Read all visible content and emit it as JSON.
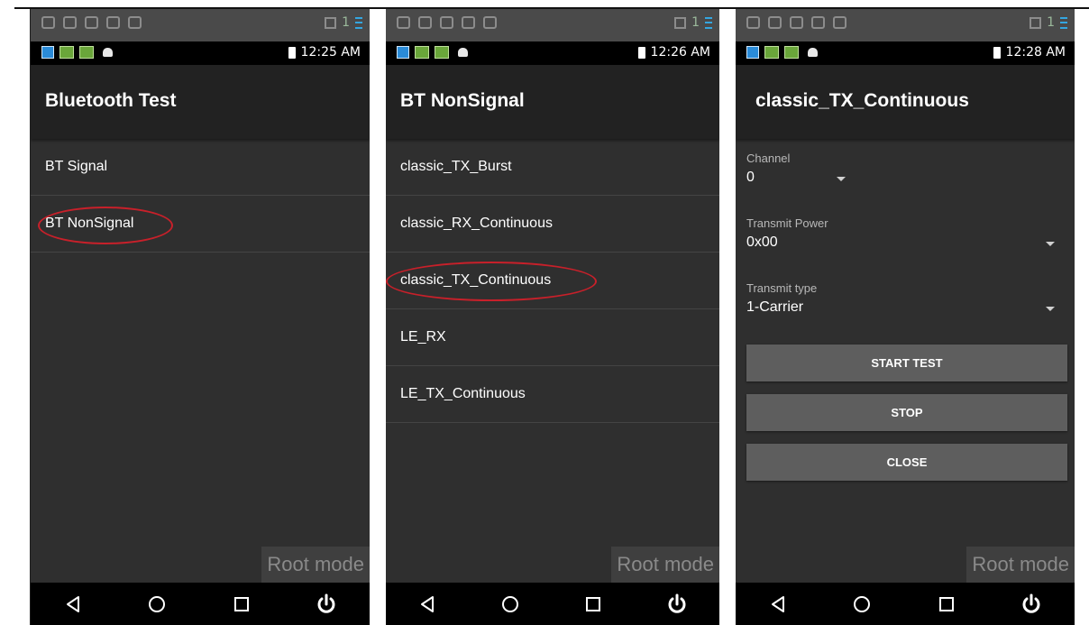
{
  "panels": [
    {
      "time": "12:25 AM",
      "title": "Bluetooth Test",
      "items": [
        "BT Signal",
        "BT NonSignal"
      ],
      "root_label": "Root mode"
    },
    {
      "time": "12:26 AM",
      "title": "BT NonSignal",
      "items": [
        "classic_TX_Burst",
        "classic_RX_Continuous",
        "classic_TX_Continuous",
        "LE_RX",
        "LE_TX_Continuous"
      ],
      "root_label": "Root mode"
    },
    {
      "time": "12:28 AM",
      "title": "classic_TX_Continuous",
      "fields": [
        {
          "label": "Channel",
          "value": "0"
        },
        {
          "label": "Transmit Power",
          "value": "0x00"
        },
        {
          "label": "Transmit type",
          "value": "1-Carrier"
        }
      ],
      "buttons": [
        "START TEST",
        "STOP",
        "CLOSE"
      ],
      "root_label": "Root mode"
    }
  ],
  "status_icons": {
    "sim_count": "1"
  },
  "highlight_color": "#c8202a",
  "icons": [
    "back-icon",
    "home-icon",
    "recents-icon",
    "power-icon"
  ]
}
